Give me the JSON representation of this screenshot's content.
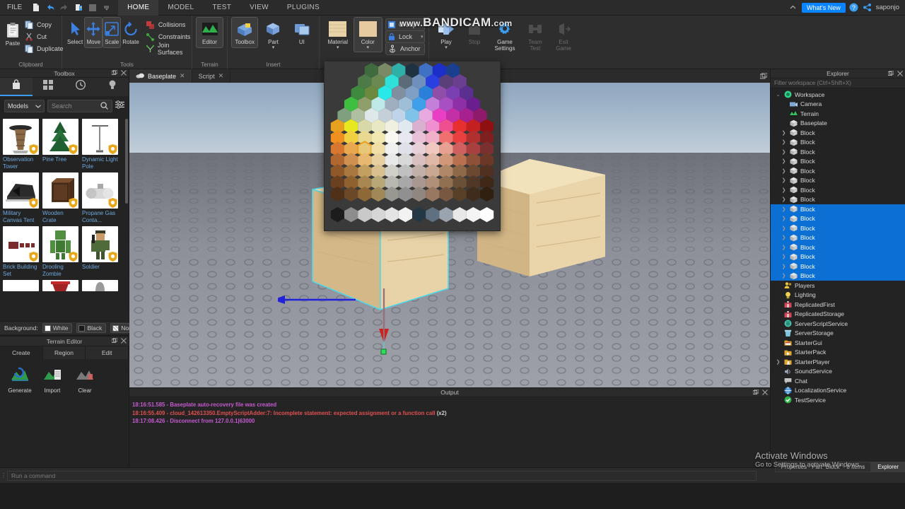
{
  "menubar": {
    "file_label": "FILE",
    "quick_icons": [
      "new-file-icon",
      "undo-icon",
      "redo-icon",
      "publish-icon",
      "stop-square-icon",
      "customize-caret-icon"
    ],
    "tabs": [
      {
        "label": "HOME",
        "active": true
      },
      {
        "label": "MODEL",
        "active": false
      },
      {
        "label": "TEST",
        "active": false
      },
      {
        "label": "VIEW",
        "active": false
      },
      {
        "label": "PLUGINS",
        "active": false
      }
    ],
    "whats_new": "What's New",
    "username": "saponjo",
    "collapse_icon": "chevron-up-icon",
    "help_icon": "help-circle-icon",
    "share_icon": "share-icon"
  },
  "watermark": {
    "prefix": "www.",
    "brand": "BANDICAM",
    "suffix": ".com",
    "activate_title": "Activate Windows",
    "activate_sub": "Go to Settings to activate Windows."
  },
  "ribbon": {
    "groups": [
      {
        "name": "Clipboard",
        "label": "Clipboard",
        "big": [
          {
            "label": "Paste",
            "icon": "paste-icon",
            "selected": false,
            "disabled": false
          }
        ],
        "small": [
          {
            "label": "Copy",
            "icon": "copy-icon"
          },
          {
            "label": "Cut",
            "icon": "cut-icon"
          },
          {
            "label": "Duplicate",
            "icon": "duplicate-icon"
          }
        ]
      },
      {
        "name": "Tools",
        "label": "Tools",
        "big": [
          {
            "label": "Select",
            "icon": "cursor-arrow-icon",
            "selected": false
          },
          {
            "label": "Move",
            "icon": "move-arrows-icon",
            "selected": true
          },
          {
            "label": "Scale",
            "icon": "scale-icon",
            "selected": true
          },
          {
            "label": "Rotate",
            "icon": "rotate-icon",
            "selected": false
          }
        ],
        "small": [
          {
            "label": "Collisions",
            "icon": "collisions-icon"
          },
          {
            "label": "Constraints",
            "icon": "constraints-icon"
          },
          {
            "label": "Join Surfaces",
            "icon": "join-surfaces-icon"
          }
        ]
      },
      {
        "name": "Terrain",
        "label": "Terrain",
        "big": [
          {
            "label": "Editor",
            "icon": "terrain-editor-icon",
            "selected": true
          }
        ],
        "small": []
      },
      {
        "name": "Insert",
        "label": "Insert",
        "big": [
          {
            "label": "Toolbox",
            "icon": "toolbox-icon",
            "selected": true
          },
          {
            "label": "Part",
            "icon": "part-cube-icon",
            "selected": false,
            "caret": true
          },
          {
            "label": "UI",
            "icon": "ui-icon",
            "selected": false
          }
        ],
        "small": []
      },
      {
        "name": "Edit",
        "label": "",
        "big": [
          {
            "label": "Material",
            "icon": "material-swatch-icon",
            "selected": false,
            "caret": true
          },
          {
            "label": "Color",
            "icon": "color-swatch-icon",
            "selected": true,
            "caret": true
          }
        ],
        "small": [
          {
            "label": "Group",
            "icon": "group-icon",
            "caret": true
          },
          {
            "label": "Lock",
            "icon": "lock-icon",
            "caret": true
          },
          {
            "label": "Anchor",
            "icon": "anchor-icon",
            "caret": false
          }
        ]
      },
      {
        "name": "Test",
        "label": "",
        "big": [
          {
            "label": "Play",
            "icon": "play-icon",
            "selected": false,
            "caret": true,
            "disabled": false
          },
          {
            "label": "Stop",
            "icon": "stop-icon",
            "selected": false,
            "disabled": true
          },
          {
            "label": "Game Settings",
            "icon": "gear-icon",
            "selected": false,
            "disabled": false
          },
          {
            "label": "Team Test",
            "icon": "team-test-icon",
            "selected": false,
            "disabled": true
          },
          {
            "label": "Exit Game",
            "icon": "exit-game-icon",
            "selected": false,
            "disabled": true
          }
        ],
        "small": []
      }
    ]
  },
  "toolbox": {
    "title": "Toolbox",
    "undock_icon": "undock-icon",
    "close_icon": "close-icon",
    "tabs": [
      {
        "icon": "marketplace-bag-icon",
        "active": true
      },
      {
        "icon": "inventory-grid-icon",
        "active": false
      },
      {
        "icon": "recent-clock-icon",
        "active": false
      },
      {
        "icon": "creations-bulb-icon",
        "active": false
      }
    ],
    "category": "Models",
    "category_caret": "chevron-down-icon",
    "search_placeholder": "Search",
    "search_icon": "search-icon",
    "filter_icon": "filter-sliders-icon",
    "items": [
      {
        "name": "Observation Tower",
        "thumb": "observation-tower"
      },
      {
        "name": "Pine Tree",
        "thumb": "pine-tree"
      },
      {
        "name": "Dynamic Light Pole",
        "thumb": "light-pole"
      },
      {
        "name": "Military Canvas Tent",
        "thumb": "canvas-tent"
      },
      {
        "name": "Wooden Crate",
        "thumb": "wooden-crate"
      },
      {
        "name": "Propane Gas Conta...",
        "thumb": "propane-tank"
      },
      {
        "name": "Brick Building Set",
        "thumb": "brick-set"
      },
      {
        "name": "Drooling Zombie",
        "thumb": "zombie"
      },
      {
        "name": "Soldier",
        "thumb": "soldier"
      }
    ],
    "background_label": "Background:",
    "background_options": [
      {
        "label": "White",
        "swatch": "#ffffff"
      },
      {
        "label": "Black",
        "swatch": "#1a1a1a"
      },
      {
        "label": "None",
        "swatch": "checker"
      }
    ]
  },
  "terrain_editor": {
    "title": "Terrain Editor",
    "undock_icon": "undock-icon",
    "close_icon": "close-icon",
    "tabs": [
      {
        "label": "Create",
        "active": true
      },
      {
        "label": "Region",
        "active": false
      },
      {
        "label": "Edit",
        "active": false
      }
    ],
    "tools": [
      {
        "label": "Generate",
        "icon": "terrain-generate-icon"
      },
      {
        "label": "Import",
        "icon": "terrain-import-icon"
      },
      {
        "label": "Clear",
        "icon": "terrain-clear-icon"
      }
    ]
  },
  "viewport": {
    "tabs": [
      {
        "label": "Baseplate",
        "icon": "place-cloud-icon",
        "active": true,
        "close_icon": "close-icon"
      },
      {
        "label": "Script",
        "icon": "",
        "active": false,
        "close_icon": "close-icon"
      }
    ],
    "dock_icon": "dock-icon",
    "gizmo": {
      "x_axis_color": "#2222dd",
      "y_axis_color": "#dd2222",
      "selection_box_color": "#4fd8e8"
    }
  },
  "color_picker": {
    "name": "BrickColor palette popup",
    "selected_swatch_outline": "#e8a020",
    "rows": [
      [
        "#3f6b3f",
        "#7a8a66",
        "#2eb0a8",
        "#1f3242",
        "#3f72c4",
        "#1d2fc9",
        "#1a3f8f"
      ],
      [
        "#4d7a46",
        "#6b8a52",
        "#2ee0d8",
        "#5c6b78",
        "#6f8fbc",
        "#2a3fe0",
        "#5b3f78",
        "#6b3f8f"
      ],
      [
        "#3f8a3f",
        "#6b8a3f",
        "#28e8e8",
        "#7f8f9f",
        "#7f9fc4",
        "#2a7fd8",
        "#8f4fa8",
        "#7a3fb0",
        "#5b2f8f"
      ],
      [
        "#3fbf3f",
        "#8f9f6b",
        "#bfe8e8",
        "#9fafbf",
        "#9fbfd8",
        "#3f9fe8",
        "#c47fd8",
        "#a84fc4",
        "#8f2fa8",
        "#6b1f8f"
      ],
      [
        "#7f9f7f",
        "#afbf9f",
        "#dfe8e8",
        "#c4cfd8",
        "#bfd4e8",
        "#7fc4e8",
        "#e8a8e0",
        "#e83fc4",
        "#c42fa8",
        "#a8208f",
        "#8f1a6b"
      ],
      [
        "#e8a020",
        "#e8e820",
        "#d8d8a8",
        "#e8e8c4",
        "#f0f0e0",
        "#e0e8f0",
        "#d8b0d0",
        "#f08fd0",
        "#f04f8f",
        "#e82f2f",
        "#c42020",
        "#8f1010"
      ],
      [
        "#f09020",
        "#f0d040",
        "#e8d890",
        "#f0e8b0",
        "#f8f8f0",
        "#e8e8f0",
        "#e8c0d8",
        "#f0b0c8",
        "#f07070",
        "#e84040",
        "#b03030",
        "#7f2020"
      ],
      [
        "#d87830",
        "#e8a850",
        "#e8c878",
        "#f0e0a8",
        "#f0f0f0",
        "#e0e0e8",
        "#e8d0d8",
        "#f0c8c0",
        "#e8a090",
        "#d06060",
        "#a84040",
        "#7a3030"
      ],
      [
        "#b06830",
        "#d09050",
        "#e8b870",
        "#e8d0a0",
        "#e8e8e8",
        "#d8d8d8",
        "#d8c0c0",
        "#e0b8a8",
        "#d09878",
        "#b87050",
        "#8f5038",
        "#6b3828"
      ],
      [
        "#8f5828",
        "#a87840",
        "#c4a060",
        "#d8c090",
        "#d0d0c8",
        "#c0c0c0",
        "#c0b0a8",
        "#c8a890",
        "#b08868",
        "#8f6848",
        "#6b4830",
        "#503020"
      ],
      [
        "#6b4020",
        "#8f6030",
        "#a88850",
        "#b8a878",
        "#b8b8b0",
        "#a8a8a8",
        "#a89890",
        "#b09078",
        "#907050",
        "#6b5038",
        "#503828",
        "#3f2818"
      ],
      [
        "#4f3018",
        "#6b4828",
        "#8f6838",
        "#a08858",
        "#989890",
        "#909090",
        "#908880",
        "#987860",
        "#785840",
        "#584028",
        "#402c1c",
        "#2f2010"
      ]
    ],
    "bottom_row": [
      "#1c1c1c",
      "#8d8d8d",
      "#c9c9c9",
      "#d6d6d6",
      "#e4e4e4",
      "#f2f2f2",
      "#243744",
      "#5f7080",
      "#9aa4ae",
      "#e8e8e8",
      "#f4f4f4",
      "#ffffff"
    ]
  },
  "explorer": {
    "title": "Explorer",
    "undock_icon": "undock-icon",
    "close_icon": "close-icon",
    "filter_placeholder": "Filter workspace (Ctrl+Shift+X)",
    "tree": [
      {
        "label": "Workspace",
        "icon": "workspace-icon",
        "depth": 0,
        "arrow": "down",
        "selected": false
      },
      {
        "label": "Camera",
        "icon": "camera-icon",
        "depth": 1,
        "arrow": "",
        "selected": false
      },
      {
        "label": "Terrain",
        "icon": "terrain-icon",
        "depth": 1,
        "arrow": "",
        "selected": false
      },
      {
        "label": "Baseplate",
        "icon": "part-icon",
        "depth": 1,
        "arrow": "",
        "selected": false
      },
      {
        "label": "Block",
        "icon": "part-icon",
        "depth": 1,
        "arrow": "right",
        "selected": false
      },
      {
        "label": "Block",
        "icon": "part-icon",
        "depth": 1,
        "arrow": "right",
        "selected": false
      },
      {
        "label": "Block",
        "icon": "part-icon",
        "depth": 1,
        "arrow": "right",
        "selected": false
      },
      {
        "label": "Block",
        "icon": "part-icon",
        "depth": 1,
        "arrow": "right",
        "selected": false
      },
      {
        "label": "Block",
        "icon": "part-icon",
        "depth": 1,
        "arrow": "right",
        "selected": false
      },
      {
        "label": "Block",
        "icon": "part-icon",
        "depth": 1,
        "arrow": "right",
        "selected": false
      },
      {
        "label": "Block",
        "icon": "part-icon",
        "depth": 1,
        "arrow": "right",
        "selected": false
      },
      {
        "label": "Block",
        "icon": "part-icon",
        "depth": 1,
        "arrow": "right",
        "selected": false
      },
      {
        "label": "Block",
        "icon": "part-icon",
        "depth": 1,
        "arrow": "right",
        "selected": true
      },
      {
        "label": "Block",
        "icon": "part-icon",
        "depth": 1,
        "arrow": "right",
        "selected": true
      },
      {
        "label": "Block",
        "icon": "part-icon",
        "depth": 1,
        "arrow": "right",
        "selected": true
      },
      {
        "label": "Block",
        "icon": "part-icon",
        "depth": 1,
        "arrow": "right",
        "selected": true
      },
      {
        "label": "Block",
        "icon": "part-icon",
        "depth": 1,
        "arrow": "right",
        "selected": true
      },
      {
        "label": "Block",
        "icon": "part-icon",
        "depth": 1,
        "arrow": "right",
        "selected": true
      },
      {
        "label": "Block",
        "icon": "part-icon",
        "depth": 1,
        "arrow": "right",
        "selected": true
      },
      {
        "label": "Block",
        "icon": "part-icon",
        "depth": 1,
        "arrow": "right",
        "selected": true
      },
      {
        "label": "Players",
        "icon": "players-icon",
        "depth": 0,
        "arrow": "",
        "selected": false
      },
      {
        "label": "Lighting",
        "icon": "lighting-icon",
        "depth": 0,
        "arrow": "",
        "selected": false
      },
      {
        "label": "ReplicatedFirst",
        "icon": "replicated-icon",
        "depth": 0,
        "arrow": "",
        "selected": false
      },
      {
        "label": "ReplicatedStorage",
        "icon": "replicated-icon",
        "depth": 0,
        "arrow": "",
        "selected": false
      },
      {
        "label": "ServerScriptService",
        "icon": "server-script-icon",
        "depth": 0,
        "arrow": "",
        "selected": false
      },
      {
        "label": "ServerStorage",
        "icon": "server-storage-icon",
        "depth": 0,
        "arrow": "",
        "selected": false
      },
      {
        "label": "StarterGui",
        "icon": "folder-gui-icon",
        "depth": 0,
        "arrow": "",
        "selected": false
      },
      {
        "label": "StarterPack",
        "icon": "folder-pack-icon",
        "depth": 0,
        "arrow": "",
        "selected": false
      },
      {
        "label": "StarterPlayer",
        "icon": "folder-player-icon",
        "depth": 0,
        "arrow": "right",
        "selected": false
      },
      {
        "label": "SoundService",
        "icon": "sound-icon",
        "depth": 0,
        "arrow": "",
        "selected": false
      },
      {
        "label": "Chat",
        "icon": "chat-icon",
        "depth": 0,
        "arrow": "",
        "selected": false
      },
      {
        "label": "LocalizationService",
        "icon": "localization-icon",
        "depth": 0,
        "arrow": "",
        "selected": false
      },
      {
        "label": "TestService",
        "icon": "test-service-icon",
        "depth": 0,
        "arrow": "",
        "selected": false
      }
    ]
  },
  "output": {
    "title": "Output",
    "undock_icon": "undock-icon",
    "close_icon": "close-icon",
    "lines": [
      {
        "text": "18:16:51.585 - Baseplate auto-recovery file was created",
        "color": "#c45bd0"
      },
      {
        "text": "18:16:55.409 - cloud_142613350.EmptyScriptAdder:7: Incomplete statement: expected assignment or a function call",
        "color": "#e05050",
        "suffix": " (x2)",
        "suffix_color": "#cfcfcf"
      },
      {
        "text": "18:17:08.426 - Disconnect from 127.0.0.1|63000",
        "color": "#c45bd0"
      }
    ]
  },
  "statusbar": {
    "command_placeholder": "Run a command",
    "tabs": [
      {
        "label": "Properties - Part \"Block\" - 8 items",
        "active": false
      },
      {
        "label": "Explorer",
        "active": true
      }
    ]
  }
}
